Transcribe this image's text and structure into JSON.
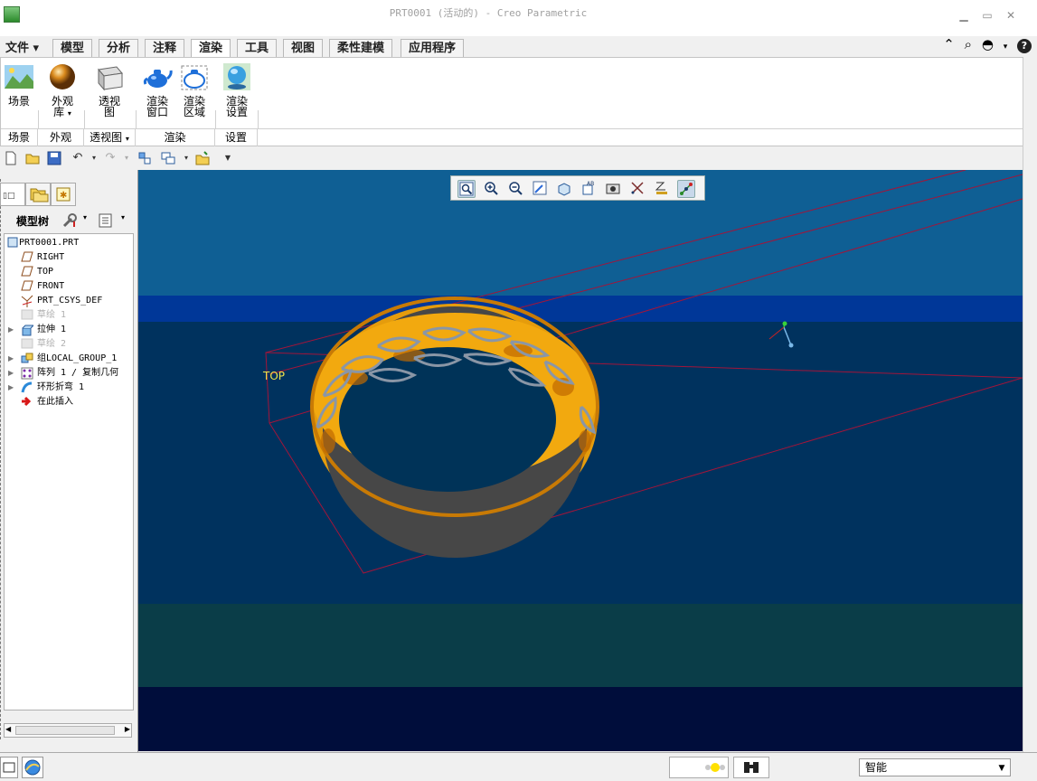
{
  "window": {
    "title": "PRT0001 (活动的) - Creo Parametric",
    "min_glyph": "▁",
    "max_glyph": "▭",
    "close_glyph": "✕"
  },
  "tabs": {
    "file": "文件",
    "items": [
      "模型",
      "分析",
      "注释",
      "渲染",
      "工具",
      "视图",
      "柔性建模",
      "应用程序"
    ],
    "active": "渲染"
  },
  "ribbon": {
    "buttons": {
      "scene": "场景",
      "appearance_lib_1": "外观",
      "appearance_lib_2": "库",
      "perspective_1": "透视",
      "perspective_2": "图",
      "render_window_1": "渲染",
      "render_window_2": "窗口",
      "render_region_1": "渲染",
      "render_region_2": "区域",
      "render_setup_1": "渲染",
      "render_setup_2": "设置"
    },
    "groups": {
      "scene": "场景",
      "appearance": "外观",
      "perspective": "透视图",
      "render": "渲染",
      "setup": "设置"
    }
  },
  "model_tree": {
    "header": "模型树",
    "items": [
      {
        "label": "PRT0001.PRT",
        "icon": "part-icon",
        "dim": false
      },
      {
        "label": "RIGHT",
        "icon": "datum-plane-icon",
        "dim": false
      },
      {
        "label": "TOP",
        "icon": "datum-plane-icon",
        "dim": false
      },
      {
        "label": "FRONT",
        "icon": "datum-plane-icon",
        "dim": false
      },
      {
        "label": "PRT_CSYS_DEF",
        "icon": "csys-icon",
        "dim": false
      },
      {
        "label": "草绘 1",
        "icon": "sketch-icon",
        "dim": true
      },
      {
        "label": "拉伸 1",
        "icon": "extrude-icon",
        "dim": false
      },
      {
        "label": "草绘 2",
        "icon": "sketch-icon",
        "dim": true
      },
      {
        "label": "组LOCAL_GROUP_1",
        "icon": "group-icon",
        "dim": false
      },
      {
        "label": "阵列 1 / 复制几何",
        "icon": "pattern-icon",
        "dim": false
      },
      {
        "label": "环形折弯 1",
        "icon": "toroidal-bend-icon",
        "dim": false
      },
      {
        "label": "在此插入",
        "icon": "insert-here-arrow-icon",
        "dim": false
      }
    ]
  },
  "viewport": {
    "datum_label": "TOP",
    "colors": {
      "band1": "#0f5f94",
      "band2": "#003798",
      "band3": "#00325e",
      "band4": "#0a3d48",
      "band5": "#000d3b",
      "ring_gold": "#f2a90f",
      "ring_inner": "#474747",
      "datum_plane": "#a2153a"
    }
  },
  "status": {
    "filter_value": "智能"
  }
}
